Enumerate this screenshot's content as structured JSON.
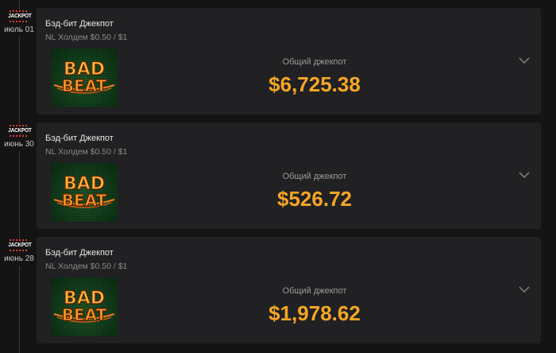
{
  "entries": [
    {
      "badge": {
        "logo_text": "JACKPOT",
        "date": "июль 01"
      },
      "title": "Бэд-бит Джекпот",
      "subtitle": "NL Холдем $0.50 / $1",
      "thumbnail": {
        "line1": "BAD",
        "line2": "BEAT"
      },
      "jackpot_label": "Общий джекпот",
      "amount": "$6,725.38"
    },
    {
      "badge": {
        "logo_text": "JACKPOT",
        "date": "июнь 30"
      },
      "title": "Бэд-бит Джекпот",
      "subtitle": "NL Холдем $0.50 / $1",
      "thumbnail": {
        "line1": "BAD",
        "line2": "BEAT"
      },
      "jackpot_label": "Общий джекпот",
      "amount": "$526.72"
    },
    {
      "badge": {
        "logo_text": "JACKPOT",
        "date": "июнь 28"
      },
      "title": "Бэд-бит Джекпот",
      "subtitle": "NL Холдем $0.50 / $1",
      "thumbnail": {
        "line1": "BAD",
        "line2": "BEAT"
      },
      "jackpot_label": "Общий джекпот",
      "amount": "$1,978.62"
    }
  ],
  "icons": {
    "expand": "chevron-down-icon",
    "badge": "jackpot-logo-icon"
  },
  "colors": {
    "background": "#141414",
    "card": "#212124",
    "amount": "#f5a623",
    "title": "#e6e6e6",
    "muted": "#8a8a8a",
    "thumbnail_bg": "#1d5a2a",
    "logo_orange": "#f07a1a"
  }
}
